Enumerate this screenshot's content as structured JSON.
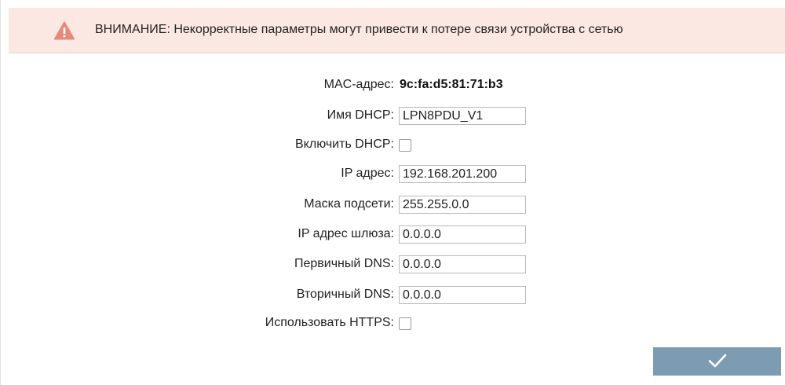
{
  "warning": {
    "icon": "warning-triangle-icon",
    "icon_color": "#e6897a",
    "text": "ВНИМАНИЕ: Некорректные параметры могут привести к потере связи устройства с сетью",
    "background": "#fce8e3"
  },
  "form": {
    "mac": {
      "label": "MAC-адрес:",
      "value": "9c:fa:d5:81:71:b3"
    },
    "dhcp_name": {
      "label": "Имя DHCP:",
      "value": "LPN8PDU_V1"
    },
    "dhcp_enable": {
      "label": "Включить DHCP:",
      "checked": false
    },
    "ip": {
      "label": "IP адрес:",
      "value": "192.168.201.200"
    },
    "mask": {
      "label": "Маска подсети:",
      "value": "255.255.0.0"
    },
    "gateway": {
      "label": "IP адрес шлюза:",
      "value": "0.0.0.0"
    },
    "dns_primary": {
      "label": "Первичный DNS:",
      "value": "0.0.0.0"
    },
    "dns_secondary": {
      "label": "Вторичный DNS:",
      "value": "0.0.0.0"
    },
    "https": {
      "label": "Использовать HTTPS:",
      "checked": false
    }
  },
  "submit": {
    "icon": "checkmark-icon",
    "color": "#7d9cb4"
  }
}
